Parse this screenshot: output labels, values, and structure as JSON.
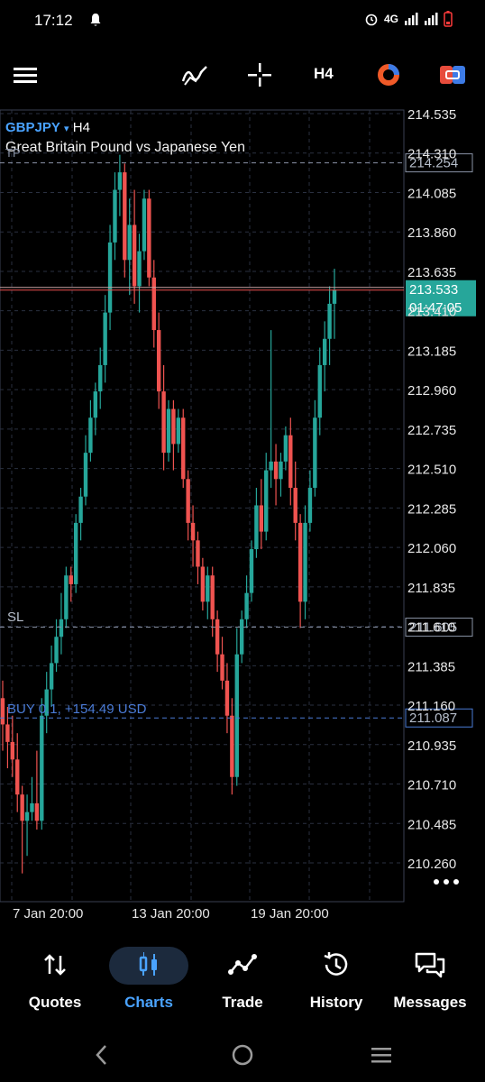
{
  "status_bar": {
    "time": "17:12",
    "network": "4G"
  },
  "toolbar": {
    "timeframe": "H4"
  },
  "chart": {
    "symbol": "GBPJPY",
    "symbol_arrow": "▾",
    "timeframe": "H4",
    "description": "Great Britain Pound vs Japanese Yen",
    "tp_label": "TP",
    "sl_label": "SL",
    "position_label": "BUY 0.1,  +154.49 USD",
    "tp_price": "214.254",
    "sl_price": "211.605",
    "entry_price": "211.087",
    "bid_price": "213.533",
    "countdown": "01:47:05",
    "more_icon": "more-dots-icon",
    "colors": {
      "bull": "#26a69a",
      "bear": "#ef5350",
      "grid": "#2a3040",
      "tp_sl": "#8a93a6",
      "position": "#4a7bd6"
    }
  },
  "chart_data": {
    "type": "candlestick",
    "y_ticks": [
      "214.535",
      "214.310",
      "214.085",
      "213.860",
      "213.635",
      "213.410",
      "213.185",
      "212.960",
      "212.735",
      "212.510",
      "212.285",
      "212.060",
      "211.835",
      "211.610",
      "211.385",
      "211.160",
      "210.935",
      "210.710",
      "210.485",
      "210.260"
    ],
    "x_ticks": [
      "7 Jan 20:00",
      "13 Jan 20:00",
      "19 Jan 20:00"
    ],
    "ylim": [
      210.15,
      214.62
    ],
    "candles": [
      [
        211.2,
        211.3,
        210.9,
        211.05
      ],
      [
        211.05,
        211.15,
        210.8,
        210.95
      ],
      [
        210.95,
        211.1,
        210.75,
        210.85
      ],
      [
        210.85,
        211.0,
        210.55,
        210.65
      ],
      [
        210.65,
        210.7,
        210.2,
        210.5
      ],
      [
        210.5,
        210.65,
        210.3,
        210.55
      ],
      [
        210.55,
        210.75,
        210.5,
        210.6
      ],
      [
        210.6,
        210.9,
        210.45,
        210.5
      ],
      [
        210.5,
        211.2,
        210.45,
        211.1
      ],
      [
        211.1,
        211.35,
        211.0,
        211.25
      ],
      [
        211.25,
        211.5,
        211.15,
        211.4
      ],
      [
        211.4,
        211.65,
        211.35,
        211.55
      ],
      [
        211.55,
        211.8,
        211.45,
        211.65
      ],
      [
        211.65,
        211.95,
        211.6,
        211.9
      ],
      [
        211.9,
        211.95,
        211.75,
        211.85
      ],
      [
        211.85,
        212.25,
        211.8,
        212.2
      ],
      [
        212.2,
        212.4,
        212.1,
        212.35
      ],
      [
        212.35,
        212.7,
        212.3,
        212.6
      ],
      [
        212.6,
        212.9,
        212.55,
        212.8
      ],
      [
        212.8,
        213.0,
        212.7,
        212.95
      ],
      [
        212.95,
        213.2,
        212.85,
        213.1
      ],
      [
        213.1,
        213.5,
        213.0,
        213.4
      ],
      [
        213.4,
        213.9,
        213.3,
        213.8
      ],
      [
        213.8,
        214.2,
        213.7,
        214.1
      ],
      [
        214.1,
        214.3,
        213.95,
        214.2
      ],
      [
        214.2,
        214.25,
        213.6,
        213.7
      ],
      [
        213.7,
        214.05,
        213.5,
        213.9
      ],
      [
        213.9,
        214.1,
        213.45,
        213.55
      ],
      [
        213.55,
        213.85,
        213.4,
        213.75
      ],
      [
        213.75,
        214.1,
        213.7,
        214.05
      ],
      [
        214.05,
        214.1,
        213.55,
        213.6
      ],
      [
        213.6,
        213.7,
        213.2,
        213.3
      ],
      [
        213.3,
        213.4,
        212.85,
        212.95
      ],
      [
        212.95,
        213.1,
        212.5,
        212.6
      ],
      [
        212.6,
        212.9,
        212.55,
        212.85
      ],
      [
        212.85,
        212.9,
        212.5,
        212.65
      ],
      [
        212.65,
        212.85,
        212.6,
        212.8
      ],
      [
        212.8,
        212.85,
        212.4,
        212.45
      ],
      [
        212.45,
        212.5,
        212.1,
        212.2
      ],
      [
        212.2,
        212.3,
        211.95,
        212.1
      ],
      [
        212.1,
        212.15,
        211.85,
        211.95
      ],
      [
        211.95,
        212.0,
        211.7,
        211.75
      ],
      [
        211.75,
        211.95,
        211.65,
        211.9
      ],
      [
        211.9,
        211.95,
        211.55,
        211.65
      ],
      [
        211.65,
        211.7,
        211.35,
        211.45
      ],
      [
        211.45,
        211.55,
        211.25,
        211.3
      ],
      [
        211.3,
        211.4,
        211.0,
        211.1
      ],
      [
        211.1,
        211.2,
        210.65,
        210.75
      ],
      [
        210.75,
        211.6,
        210.7,
        211.45
      ],
      [
        211.45,
        211.7,
        211.4,
        211.65
      ],
      [
        211.65,
        211.9,
        211.6,
        211.8
      ],
      [
        211.8,
        212.1,
        211.75,
        212.05
      ],
      [
        212.05,
        212.4,
        212.0,
        212.3
      ],
      [
        212.3,
        212.45,
        212.05,
        212.15
      ],
      [
        212.15,
        212.6,
        212.1,
        212.5
      ],
      [
        212.5,
        213.3,
        212.4,
        212.55
      ],
      [
        212.55,
        212.65,
        212.3,
        212.45
      ],
      [
        212.45,
        212.6,
        212.35,
        212.55
      ],
      [
        212.55,
        212.75,
        212.5,
        212.7
      ],
      [
        212.7,
        212.8,
        212.3,
        212.4
      ],
      [
        212.4,
        212.55,
        212.1,
        212.2
      ],
      [
        212.2,
        212.25,
        211.6,
        211.75
      ],
      [
        211.75,
        212.3,
        211.65,
        212.2
      ],
      [
        212.2,
        212.5,
        212.15,
        212.4
      ],
      [
        212.4,
        212.9,
        212.35,
        212.8
      ],
      [
        212.8,
        213.2,
        212.7,
        213.1
      ],
      [
        213.1,
        213.35,
        212.95,
        213.25
      ],
      [
        213.25,
        213.55,
        213.1,
        213.45
      ],
      [
        213.45,
        213.65,
        213.25,
        213.53
      ]
    ]
  },
  "nav": {
    "items": [
      {
        "label": "Quotes",
        "icon": "quotes-icon"
      },
      {
        "label": "Charts",
        "icon": "charts-icon"
      },
      {
        "label": "Trade",
        "icon": "trade-icon"
      },
      {
        "label": "History",
        "icon": "history-icon"
      },
      {
        "label": "Messages",
        "icon": "messages-icon"
      }
    ]
  }
}
